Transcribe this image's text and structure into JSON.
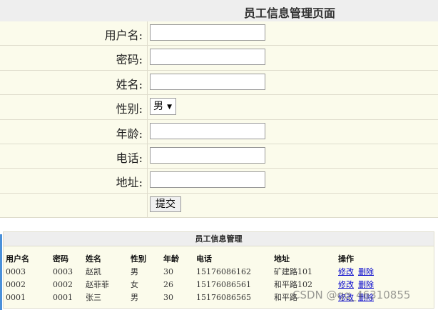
{
  "header": {
    "title": "员工信息管理页面"
  },
  "form": {
    "fields": [
      {
        "label": "用户名:",
        "type": "text",
        "value": ""
      },
      {
        "label": "密码:",
        "type": "text",
        "value": ""
      },
      {
        "label": "姓名:",
        "type": "text",
        "value": ""
      },
      {
        "label": "性别:",
        "type": "select",
        "value": "男"
      },
      {
        "label": "年龄:",
        "type": "text",
        "value": ""
      },
      {
        "label": "电话:",
        "type": "text",
        "value": ""
      },
      {
        "label": "地址:",
        "type": "text",
        "value": ""
      }
    ],
    "submit_label": "提交"
  },
  "list": {
    "title": "员工信息管理",
    "columns": [
      "用户名",
      "密码",
      "姓名",
      "性别",
      "年龄",
      "电话",
      "地址",
      "操作"
    ],
    "rows": [
      [
        "0003",
        "0003",
        "赵凯",
        "男",
        "30",
        "15176086162",
        "矿建路101"
      ],
      [
        "0002",
        "0002",
        "赵菲菲",
        "女",
        "26",
        "15176086561",
        "和平路102"
      ],
      [
        "0001",
        "0001",
        "张三",
        "男",
        "30",
        "15176086565",
        "和平路"
      ]
    ],
    "action_edit": "修改",
    "action_delete": "删除"
  },
  "watermark": "CSDN @qq_46310855",
  "colors": {
    "form_bg": "#fbfbeb",
    "header_bg": "#eeeeee",
    "link": "#0000cc"
  }
}
